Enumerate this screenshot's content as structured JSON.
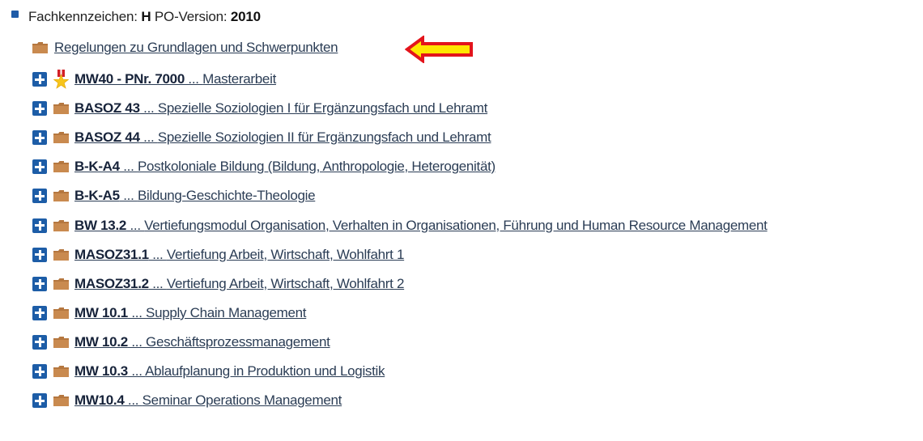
{
  "header": {
    "fachkennzeichen_label": "Fachkennzeichen: ",
    "fachkennzeichen_value": "H",
    "po_label": " PO-Version: ",
    "po_value": "2010"
  },
  "rules_link": "Regelungen zu Grundlagen und Schwerpunkten",
  "colors": {
    "accent_blue": "#1d5da7",
    "folder_brown": "#b5773f",
    "arrow_red": "#e3141b",
    "arrow_yellow": "#ffe600"
  },
  "items": [
    {
      "code": "MW40 - PNr. 7000",
      "sep": " ... ",
      "title": "Masterarbeit",
      "icon": "award-star-icon"
    },
    {
      "code": "BASOZ 43",
      "sep": " ... ",
      "title": "Spezielle Soziologien I für Ergänzungsfach und Lehramt",
      "icon": "folder-icon"
    },
    {
      "code": "BASOZ 44",
      "sep": " ... ",
      "title": "Spezielle Soziologien II für Ergänzungsfach und Lehramt",
      "icon": "folder-icon"
    },
    {
      "code": "B-K-A4",
      "sep": " ... ",
      "title": "Postkoloniale Bildung (Bildung, Anthropologie, Heterogenität)",
      "icon": "folder-icon"
    },
    {
      "code": "B-K-A5",
      "sep": " ... ",
      "title": "Bildung-Geschichte-Theologie",
      "icon": "folder-icon"
    },
    {
      "code": "BW 13.2",
      "sep": " ... ",
      "title": "Vertiefungsmodul Organisation, Verhalten in Organisationen, Führung und Human Resource Management",
      "icon": "folder-icon"
    },
    {
      "code": "MASOZ31.1",
      "sep": " ... ",
      "title": "Vertiefung Arbeit, Wirtschaft, Wohlfahrt 1",
      "icon": "folder-icon"
    },
    {
      "code": "MASOZ31.2",
      "sep": " ... ",
      "title": "Vertiefung Arbeit, Wirtschaft, Wohlfahrt 2",
      "icon": "folder-icon"
    },
    {
      "code": "MW 10.1",
      "sep": " ... ",
      "title": "Supply Chain Management",
      "icon": "folder-icon"
    },
    {
      "code": "MW 10.2",
      "sep": " ... ",
      "title": "Geschäftsprozessmanagement",
      "icon": "folder-icon"
    },
    {
      "code": "MW 10.3",
      "sep": " ... ",
      "title": "Ablaufplanung in Produktion und Logistik",
      "icon": "folder-icon"
    },
    {
      "code": "MW10.4",
      "sep": " ... ",
      "title": "Seminar Operations Management",
      "icon": "folder-icon"
    }
  ]
}
